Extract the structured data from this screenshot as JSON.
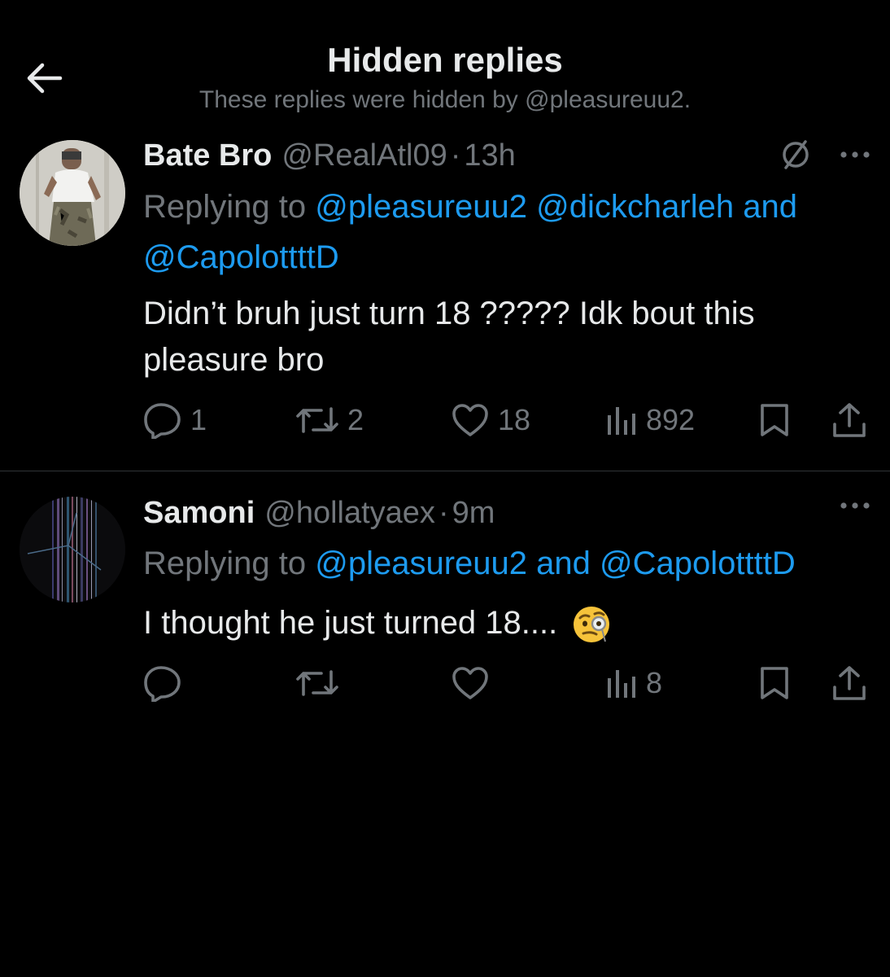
{
  "header": {
    "title": "Hidden replies",
    "subtitle": "These replies were hidden by @pleasureuu2."
  },
  "replies": [
    {
      "name": "Bate Bro",
      "handle": "@RealAtl09",
      "separator": "·",
      "time": "13h",
      "replying_prefix": "Replying to",
      "mentions": [
        "@pleasureuu2",
        "@dickcharleh",
        "@CapolottttD"
      ],
      "conjunction": "and",
      "text_line1": "Didn’t bruh just turn 18 ????? Idk bout this",
      "text_line2": "pleasure bro",
      "counts": {
        "replies": "1",
        "reposts": "2",
        "likes": "18",
        "views": "892"
      }
    },
    {
      "name": "Samoni",
      "handle": "@hollatyaex",
      "separator": "·",
      "time": "9m",
      "replying_prefix": "Replying to",
      "mentions": [
        "@pleasureuu2",
        "@CapolottttD"
      ],
      "conjunction": "and",
      "text": "I thought he just turned 18....",
      "counts": {
        "replies": "",
        "reposts": "",
        "likes": "",
        "views": "8"
      }
    }
  ],
  "colors": {
    "background": "#000000",
    "text_primary": "#e7e9ea",
    "text_secondary": "#71767b",
    "accent": "#1d9bf0",
    "divider": "#2f3336"
  },
  "icons": {
    "back": "arrow-left-icon",
    "hidden": "hidden-reply-icon",
    "more": "more-icon",
    "reply": "reply-icon",
    "repost": "repost-icon",
    "like": "like-icon",
    "views": "views-icon",
    "bookmark": "bookmark-icon",
    "share": "share-icon",
    "emoji": "face-with-monocle-emoji"
  }
}
